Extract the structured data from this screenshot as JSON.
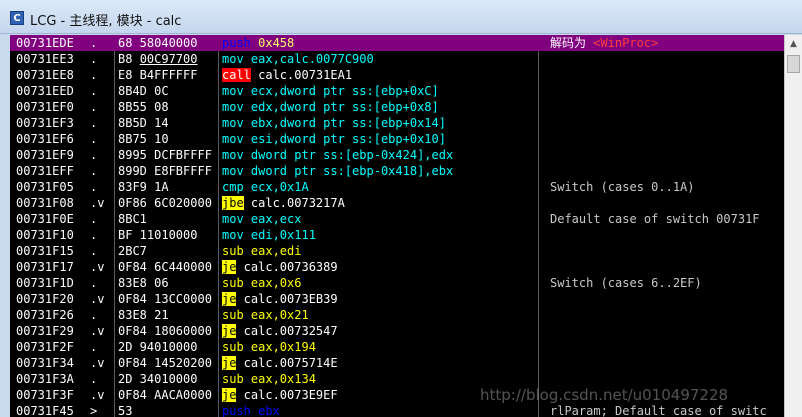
{
  "window": {
    "title": "LCG - 主线程, 模块 - calc",
    "icon_label": "C"
  },
  "colors": {
    "selected_row": "#800080",
    "call_highlight": "#ff0000",
    "jump_highlight": "#ffff00"
  },
  "mnemonic_colors": {
    "push": "#0000ff",
    "mov": "#00ffff",
    "call": "#ffffff",
    "cmp": "#00ffff",
    "sub": "#ffff00",
    "jbe": "#000000",
    "je": "#000000"
  },
  "rows": [
    {
      "addr": "00731EDE",
      "mark": ".",
      "hex": "68 58040000",
      "mn": "push",
      "ops": "0x458",
      "hl": "",
      "comment": "解码为 ",
      "comment_tag": "<WinProc>",
      "selected": true
    },
    {
      "addr": "00731EE3",
      "mark": ".",
      "hex": "B8 00C97700",
      "mn": "mov",
      "ops": "eax,calc.0077C900",
      "hl": "",
      "comment": "",
      "comment_tag": "",
      "selected": false
    },
    {
      "addr": "00731EE8",
      "mark": ".",
      "hex": "E8 B4FFFFFF",
      "mn": "call",
      "ops": "calc.00731EA1",
      "hl": "call",
      "comment": "",
      "comment_tag": "",
      "selected": false
    },
    {
      "addr": "00731EED",
      "mark": ".",
      "hex": "8B4D 0C",
      "mn": "mov",
      "ops": "ecx,dword ptr ss:[ebp+0xC]",
      "hl": "",
      "comment": "",
      "comment_tag": "",
      "selected": false
    },
    {
      "addr": "00731EF0",
      "mark": ".",
      "hex": "8B55 08",
      "mn": "mov",
      "ops": "edx,dword ptr ss:[ebp+0x8]",
      "hl": "",
      "comment": "",
      "comment_tag": "",
      "selected": false
    },
    {
      "addr": "00731EF3",
      "mark": ".",
      "hex": "8B5D 14",
      "mn": "mov",
      "ops": "ebx,dword ptr ss:[ebp+0x14]",
      "hl": "",
      "comment": "",
      "comment_tag": "",
      "selected": false
    },
    {
      "addr": "00731EF6",
      "mark": ".",
      "hex": "8B75 10",
      "mn": "mov",
      "ops": "esi,dword ptr ss:[ebp+0x10]",
      "hl": "",
      "comment": "",
      "comment_tag": "",
      "selected": false
    },
    {
      "addr": "00731EF9",
      "mark": ".",
      "hex": "8995 DCFBFFFF",
      "mn": "mov",
      "ops": "dword ptr ss:[ebp-0x424],edx",
      "hl": "",
      "comment": "",
      "comment_tag": "",
      "selected": false
    },
    {
      "addr": "00731EFF",
      "mark": ".",
      "hex": "899D E8FBFFFF",
      "mn": "mov",
      "ops": "dword ptr ss:[ebp-0x418],ebx",
      "hl": "",
      "comment": "",
      "comment_tag": "",
      "selected": false
    },
    {
      "addr": "00731F05",
      "mark": ".",
      "hex": "83F9 1A",
      "mn": "cmp",
      "ops": "ecx,0x1A",
      "hl": "",
      "comment": "Switch (cases 0..1A)",
      "comment_tag": "",
      "selected": false
    },
    {
      "addr": "00731F08",
      "mark": ".v",
      "hex": "0F86 6C020000",
      "mn": "jbe",
      "ops": "calc.0073217A",
      "hl": "jmp",
      "comment": "",
      "comment_tag": "",
      "selected": false
    },
    {
      "addr": "00731F0E",
      "mark": ".",
      "hex": "8BC1",
      "mn": "mov",
      "ops": "eax,ecx",
      "hl": "",
      "comment": "Default case of switch 00731F",
      "comment_tag": "",
      "selected": false
    },
    {
      "addr": "00731F10",
      "mark": ".",
      "hex": "BF 11010000",
      "mn": "mov",
      "ops": "edi,0x111",
      "hl": "",
      "comment": "",
      "comment_tag": "",
      "selected": false
    },
    {
      "addr": "00731F15",
      "mark": ".",
      "hex": "2BC7",
      "mn": "sub",
      "ops": "eax,edi",
      "hl": "",
      "comment": "",
      "comment_tag": "",
      "selected": false
    },
    {
      "addr": "00731F17",
      "mark": ".v",
      "hex": "0F84 6C440000",
      "mn": "je",
      "ops": "calc.00736389",
      "hl": "jmp",
      "comment": "",
      "comment_tag": "",
      "selected": false
    },
    {
      "addr": "00731F1D",
      "mark": ".",
      "hex": "83E8 06",
      "mn": "sub",
      "ops": "eax,0x6",
      "hl": "",
      "comment": "Switch (cases 6..2EF)",
      "comment_tag": "",
      "selected": false
    },
    {
      "addr": "00731F20",
      "mark": ".v",
      "hex": "0F84 13CC0000",
      "mn": "je",
      "ops": "calc.0073EB39",
      "hl": "jmp",
      "comment": "",
      "comment_tag": "",
      "selected": false
    },
    {
      "addr": "00731F26",
      "mark": ".",
      "hex": "83E8 21",
      "mn": "sub",
      "ops": "eax,0x21",
      "hl": "",
      "comment": "",
      "comment_tag": "",
      "selected": false
    },
    {
      "addr": "00731F29",
      "mark": ".v",
      "hex": "0F84 18060000",
      "mn": "je",
      "ops": "calc.00732547",
      "hl": "jmp",
      "comment": "",
      "comment_tag": "",
      "selected": false
    },
    {
      "addr": "00731F2F",
      "mark": ".",
      "hex": "2D 94010000",
      "mn": "sub",
      "ops": "eax,0x194",
      "hl": "",
      "comment": "",
      "comment_tag": "",
      "selected": false
    },
    {
      "addr": "00731F34",
      "mark": ".v",
      "hex": "0F84 14520200",
      "mn": "je",
      "ops": "calc.0075714E",
      "hl": "jmp",
      "comment": "",
      "comment_tag": "",
      "selected": false
    },
    {
      "addr": "00731F3A",
      "mark": ".",
      "hex": "2D 34010000",
      "mn": "sub",
      "ops": "eax,0x134",
      "hl": "",
      "comment": "",
      "comment_tag": "",
      "selected": false
    },
    {
      "addr": "00731F3F",
      "mark": ".v",
      "hex": "0F84 AACA0000",
      "mn": "je",
      "ops": "calc.0073E9EF",
      "hl": "jmp",
      "comment": "",
      "comment_tag": "",
      "selected": false
    },
    {
      "addr": "00731F45",
      "mark": ">",
      "hex": "53",
      "mn": "push",
      "ops": "ebx",
      "hl": "",
      "comment": "rlParam; Default case of switc",
      "comment_tag": "",
      "selected": false
    }
  ],
  "watermark": "http://blog.csdn.net/u010497228"
}
